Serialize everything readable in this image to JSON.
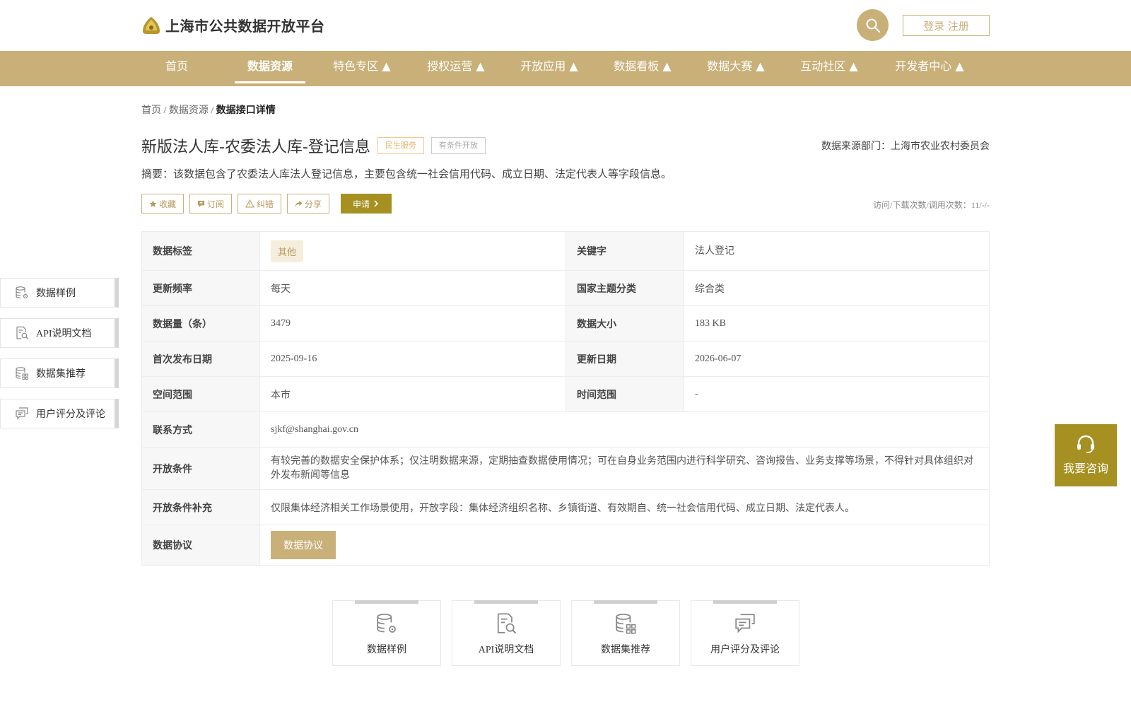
{
  "header": {
    "site_title": "上海市公共数据开放平台",
    "login_label": "登录 注册"
  },
  "nav": {
    "items": [
      {
        "label": "首页"
      },
      {
        "label": "数据资源"
      },
      {
        "label": "特色专区 ▲"
      },
      {
        "label": "授权运营 ▲"
      },
      {
        "label": "开放应用 ▲"
      },
      {
        "label": "数据看板 ▲"
      },
      {
        "label": "数据大赛 ▲"
      },
      {
        "label": "互动社区 ▲"
      },
      {
        "label": "开发者中心 ▲"
      }
    ],
    "active_index": 1
  },
  "breadcrumb": {
    "home": "首页",
    "sep1": " / ",
    "section": "数据资源",
    "sep2": " / ",
    "current": "数据接口详情"
  },
  "dataset": {
    "title": "新版法人库-农委法人库-登记信息",
    "tag1": "民生服务",
    "tag2": "有条件开放",
    "source": "数据来源部门：上海市农业农村委员会",
    "summary": "摘要：该数据包含了农委法人库法人登记信息，主要包含统一社会信用代码、成立日期、法定代表人等字段信息。",
    "stats": "访问/下载次数/调用次数：11/-/-"
  },
  "actions": {
    "favorite": "收藏",
    "subscribe": "订阅",
    "report": "纠错",
    "share": "分享",
    "apply": "申请"
  },
  "info": {
    "tag_label": "数据标签",
    "tag_value": "其他",
    "keyword_label": "关键字",
    "keyword_value": "法人登记",
    "freq_label": "更新频率",
    "freq_value": "每天",
    "theme_label": "国家主题分类",
    "theme_value": "综合类",
    "count_label": "数据量（条）",
    "count_value": "3479",
    "size_label": "数据大小",
    "size_value": "183 KB",
    "first_label": "首次发布日期",
    "first_value": "2025-09-16",
    "update_label": "更新日期",
    "update_value": "2026-06-07",
    "space_label": "空间范围",
    "space_value": "本市",
    "time_label": "时间范围",
    "time_value": "-",
    "contact_label": "联系方式",
    "contact_value": "sjkf@shanghai.gov.cn",
    "cond_label": "开放条件",
    "cond_value": "有较完善的数据安全保护体系；仅注明数据来源，定期抽查数据使用情况；可在自身业务范围内进行科学研究、咨询报告、业务支撑等场景，不得针对具体组织对外发布新闻等信息",
    "cond_extra_label": "开放条件补充",
    "cond_extra_value": "仅限集体经济相关工作场景使用，开放字段：集体经济组织名称、乡镇街道、有效期自、统一社会信用代码、成立日期、法定代表人。",
    "protocol_label": "数据协议",
    "protocol_button": "数据协议"
  },
  "side_nav": [
    {
      "label": "数据样例",
      "icon": "database-gear-icon"
    },
    {
      "label": "API说明文档",
      "icon": "document-search-icon"
    },
    {
      "label": "数据集推荐",
      "icon": "database-grid-icon"
    },
    {
      "label": "用户评分及评论",
      "icon": "comments-icon"
    }
  ],
  "consult": {
    "label": "我要咨询"
  },
  "cards": [
    {
      "label": "数据样例"
    },
    {
      "label": "API说明文档"
    },
    {
      "label": "数据集推荐"
    },
    {
      "label": "用户评分及评论"
    }
  ],
  "colors": {
    "brand": "#c9b079",
    "accent": "#a59021"
  }
}
